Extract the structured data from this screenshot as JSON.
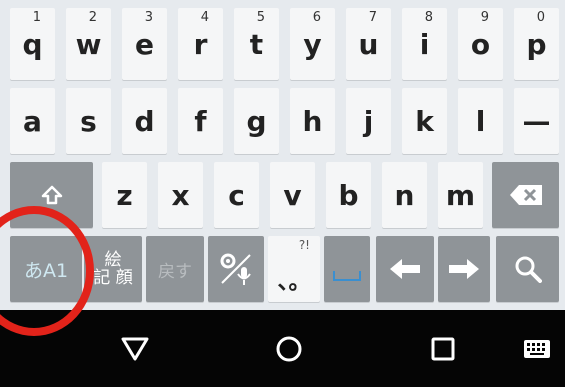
{
  "keyboard": {
    "row1": [
      {
        "key": "q",
        "hint": "1"
      },
      {
        "key": "w",
        "hint": "2"
      },
      {
        "key": "e",
        "hint": "3"
      },
      {
        "key": "r",
        "hint": "4"
      },
      {
        "key": "t",
        "hint": "5"
      },
      {
        "key": "y",
        "hint": "6"
      },
      {
        "key": "u",
        "hint": "7"
      },
      {
        "key": "i",
        "hint": "8"
      },
      {
        "key": "o",
        "hint": "9"
      },
      {
        "key": "p",
        "hint": "0"
      }
    ],
    "row2": [
      "a",
      "s",
      "d",
      "f",
      "g",
      "h",
      "j",
      "k",
      "l",
      "—"
    ],
    "row3": [
      "z",
      "x",
      "c",
      "v",
      "b",
      "n",
      "m"
    ],
    "mode_label": "あA1",
    "symbol_label_top": "絵",
    "symbol_label_bottom": "記 顔",
    "undo_label": "戻す",
    "punct_hint": "?!",
    "punct_label": "、。"
  },
  "colors": {
    "key_bg": "#f5f6f7",
    "function_key_bg": "#8f9498",
    "nav_bg": "#050505",
    "annotation": "#e2231a",
    "accent": "#3a8fd0"
  },
  "icons": {
    "shift": "shift-icon",
    "backspace": "backspace-icon",
    "settings_voice": "settings-mic-icon",
    "space": "space-icon",
    "left": "arrow-left-icon",
    "right": "arrow-right-icon",
    "search": "search-icon",
    "back": "nav-back-icon",
    "home": "nav-home-icon",
    "recents": "nav-recents-icon",
    "keyboard": "keyboard-icon"
  }
}
